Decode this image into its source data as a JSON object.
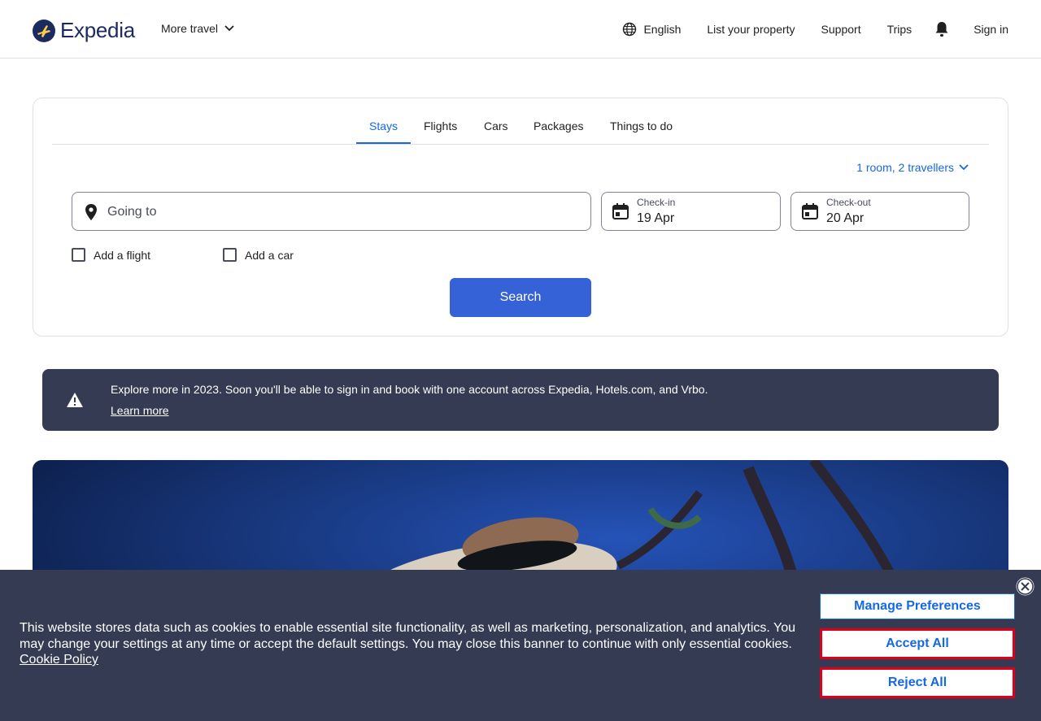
{
  "header": {
    "brand": "Expedia",
    "more_travel": "More travel",
    "language": "English",
    "list_property": "List your property",
    "support": "Support",
    "trips": "Trips",
    "sign_in": "Sign in"
  },
  "search": {
    "tabs": [
      {
        "label": "Stays",
        "active": true
      },
      {
        "label": "Flights",
        "active": false
      },
      {
        "label": "Cars",
        "active": false
      },
      {
        "label": "Packages",
        "active": false
      },
      {
        "label": "Things to do",
        "active": false
      }
    ],
    "travellers": "1 room, 2 travellers",
    "going_to_placeholder": "Going to",
    "check_in_label": "Check-in",
    "check_in_value": "19 Apr",
    "check_out_label": "Check-out",
    "check_out_value": "20 Apr",
    "add_flight": "Add a flight",
    "add_car": "Add a car",
    "search_button": "Search"
  },
  "notice": {
    "text": "Explore more in 2023. Soon you'll be able to sign in and book with one account across Expedia, Hotels.com, and Vrbo.",
    "link": "Learn more"
  },
  "cookie_banner": {
    "text": "This website stores data such as cookies to enable essential site functionality, as well as marketing, personalization, and analytics. You may change your settings at any time or accept the default settings. You may close this banner to continue with only essential cookies.",
    "policy_link": "Cookie Policy",
    "manage_button": "Manage Preferences",
    "accept_button": "Accept All",
    "reject_button": "Reject All"
  },
  "colors": {
    "accent": "#1668e3",
    "search_button": "#3662d8",
    "brand_navy": "#1b2b5f",
    "banner_bg": "#343b53",
    "highlight_border": "#e0001c"
  },
  "icons": {
    "logo": "expedia-plane-logo",
    "chevron": "chevron-down-icon",
    "globe": "globe-icon",
    "bell": "bell-icon",
    "location": "location-pin-icon",
    "calendar": "calendar-icon",
    "warning": "warning-icon",
    "close": "close-icon"
  }
}
